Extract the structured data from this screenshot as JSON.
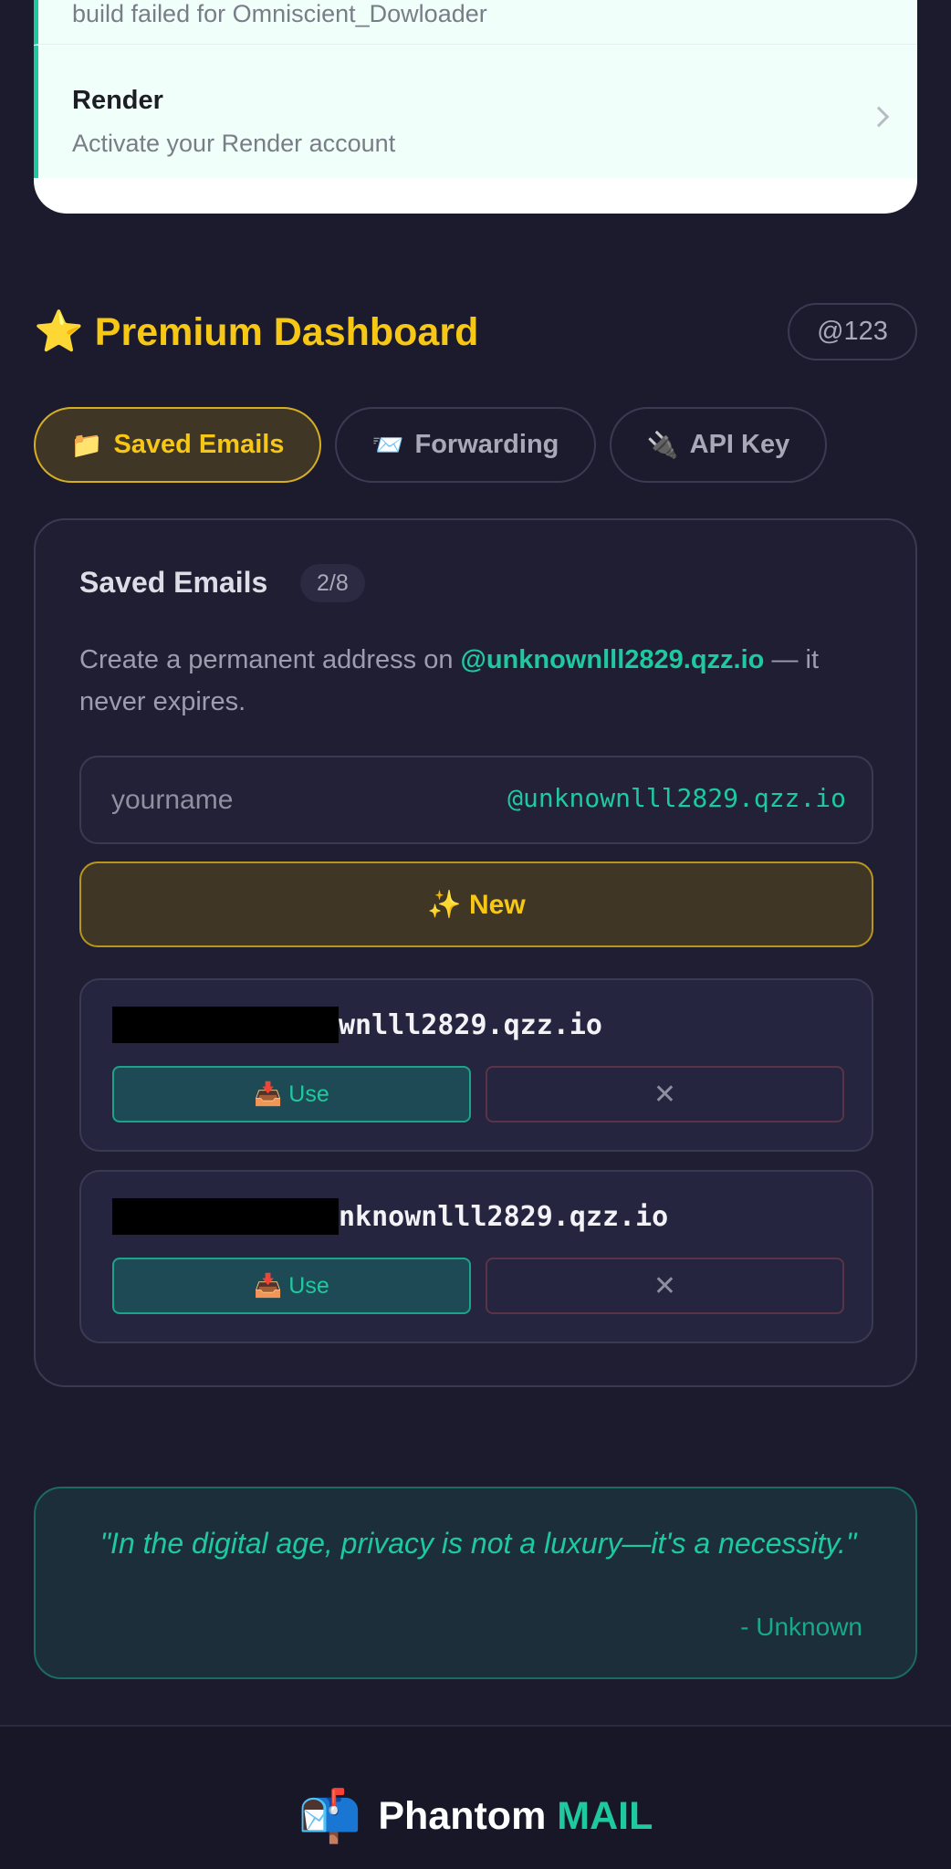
{
  "notifications": [
    {
      "subtitle": "build failed for Omniscient_Dowloader"
    },
    {
      "title": "Render",
      "subtitle": "Activate your Render account"
    }
  ],
  "dashboard": {
    "star_icon": "⭐",
    "title": "Premium Dashboard",
    "user_badge": "@123"
  },
  "tabs": [
    {
      "icon": "📁",
      "label": "Saved Emails",
      "active": true
    },
    {
      "icon": "📨",
      "label": "Forwarding",
      "active": false
    },
    {
      "icon": "🔌",
      "label": "API Key",
      "active": false
    }
  ],
  "saved_emails": {
    "title": "Saved Emails",
    "count": "2/8",
    "description_prefix": "Create a permanent address on",
    "description_domain": "@unknownlll2829.qzz.io",
    "description_suffix": "— it never expires.",
    "input_placeholder": "yourname",
    "input_value": "",
    "domain_suffix": "@unknownlll2829.qzz.io",
    "new_button": "✨ New",
    "emails": [
      {
        "visible_part": "wnlll2829.qzz.io",
        "use_label": "📥 Use",
        "delete_label": "✕"
      },
      {
        "visible_part": "nknownlll2829.qzz.io",
        "use_label": "📥 Use",
        "delete_label": "✕"
      }
    ]
  },
  "quote": {
    "text": "\"In the digital age, privacy is not a luxury—it's a necessity.\"",
    "author": "- Unknown"
  },
  "footer": {
    "icon": "📬",
    "brand_main": "Phantom",
    "brand_accent": "MAIL"
  },
  "colors": {
    "background": "#1c1b2e",
    "accent_teal": "#1ec9a0",
    "accent_gold": "#f7c716"
  }
}
